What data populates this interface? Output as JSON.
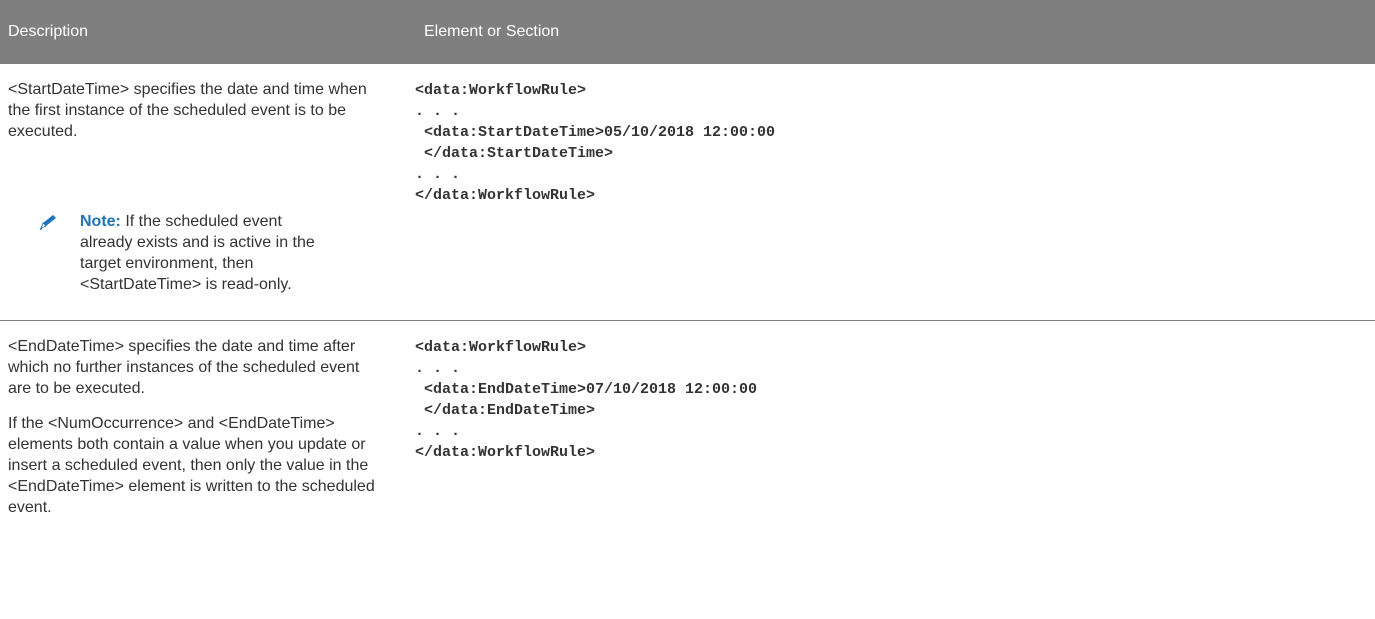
{
  "header": {
    "description": "Description",
    "element_or_section": "Element or Section"
  },
  "rows": [
    {
      "description": [
        "<StartDateTime> specifies the date and time when the first instance of the scheduled event is to be executed."
      ],
      "note": {
        "label": "Note:",
        "text_first": "If the scheduled event",
        "text_rest": "already exists and is active in the target environment, then <StartDateTime> is read-only.",
        "icon": "pencil-icon"
      },
      "code": "<data:WorkflowRule>\n. . .\n <data:StartDateTime>05/10/2018 12:00:00\n </data:StartDateTime>\n. . .\n</data:WorkflowRule>"
    },
    {
      "description": [
        "<EndDateTime> specifies the date and time after which no further instances of the scheduled event are to be executed.",
        "If the <NumOccurrence> and <EndDateTime> elements both contain a value when you update or insert a scheduled event, then only the value in the <EndDateTime> element is written to the scheduled event."
      ],
      "code": "<data:WorkflowRule>\n. . .\n <data:EndDateTime>07/10/2018 12:00:00\n </data:EndDateTime>\n. . .\n</data:WorkflowRule>"
    }
  ],
  "colors": {
    "header_bg": "#7f7f7f",
    "header_text": "#ffffff",
    "note_label": "#1f73b7",
    "body_text": "#333333"
  }
}
